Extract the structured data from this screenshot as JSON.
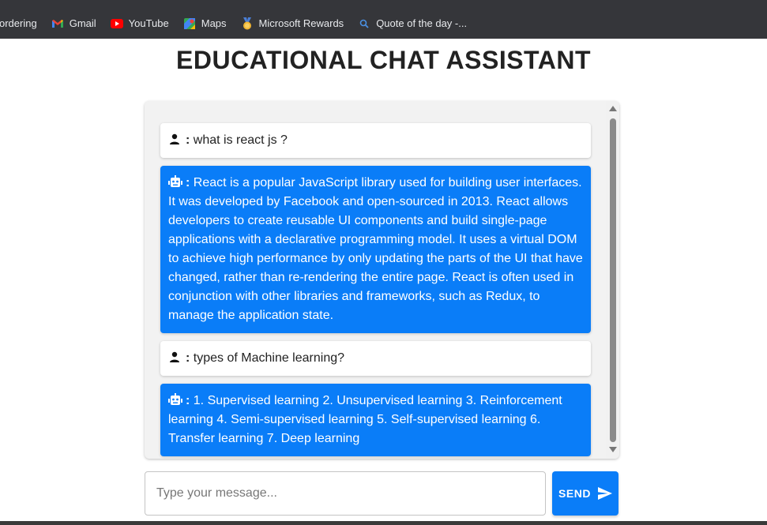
{
  "browser": {
    "bookmarks": [
      {
        "label": "ordering",
        "icon": "none"
      },
      {
        "label": "Gmail",
        "icon": "gmail-icon"
      },
      {
        "label": "YouTube",
        "icon": "youtube-icon"
      },
      {
        "label": "Maps",
        "icon": "maps-icon"
      },
      {
        "label": "Microsoft Rewards",
        "icon": "rewards-icon"
      },
      {
        "label": "Quote of the day -...",
        "icon": "search-icon"
      }
    ]
  },
  "page": {
    "title": "EDUCATIONAL CHAT ASSISTANT"
  },
  "chat": {
    "separator": ":",
    "messages": [
      {
        "role": "user",
        "icon": "user-icon",
        "text": "what is react js ?"
      },
      {
        "role": "bot",
        "icon": "robot-icon",
        "text": "React is a popular JavaScript library used for building user interfaces. It was developed by Facebook and open-sourced in 2013. React allows developers to create reusable UI components and build single-page applications with a declarative programming model. It uses a virtual DOM to achieve high performance by only updating the parts of the UI that have changed, rather than re-rendering the entire page. React is often used in conjunction with other libraries and frameworks, such as Redux, to manage the application state."
      },
      {
        "role": "user",
        "icon": "user-icon",
        "text": "types of Machine learning?"
      },
      {
        "role": "bot",
        "icon": "robot-icon",
        "text": "1. Supervised learning 2. Unsupervised learning 3. Reinforcement learning 4. Semi-supervised learning 5. Self-supervised learning 6. Transfer learning 7. Deep learning"
      }
    ]
  },
  "composer": {
    "placeholder": "Type your message...",
    "value": "",
    "send_label": "SEND"
  },
  "colors": {
    "accent": "#0a7df8",
    "chat_bg": "#f2f2f2",
    "bookmarks_bg": "#35363a"
  }
}
